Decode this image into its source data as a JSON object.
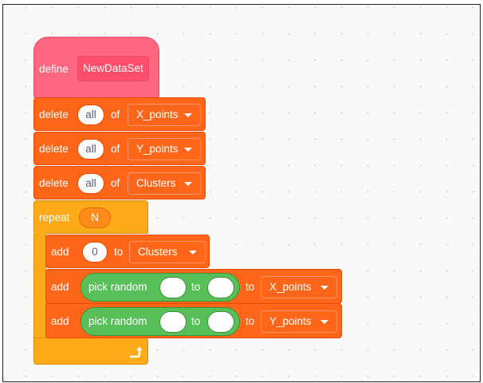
{
  "define_block": {
    "keyword": "define",
    "name": "NewDataSet"
  },
  "delete_blocks": [
    {
      "keyword": "delete",
      "value": "all",
      "of_label": "of",
      "list": "X_points"
    },
    {
      "keyword": "delete",
      "value": "all",
      "of_label": "of",
      "list": "Y_points"
    },
    {
      "keyword": "delete",
      "value": "all",
      "of_label": "of",
      "list": "Clusters"
    }
  ],
  "repeat_block": {
    "keyword": "repeat",
    "count": "N",
    "loop_icon": "loop-arrow-icon"
  },
  "add_blocks": [
    {
      "keyword": "add",
      "value": "0",
      "to_label": "to",
      "list": "Clusters"
    },
    {
      "keyword": "add",
      "operator": "pick random",
      "mid_label": "to",
      "to_label": "to",
      "list": "X_points"
    },
    {
      "keyword": "add",
      "operator": "pick random",
      "mid_label": "to",
      "to_label": "to",
      "list": "Y_points"
    }
  ],
  "colors": {
    "define": "#ff6680",
    "variables": "#ff661a",
    "control": "#ffab19",
    "operators": "#59c059",
    "canvas": "#f9f9f9"
  }
}
